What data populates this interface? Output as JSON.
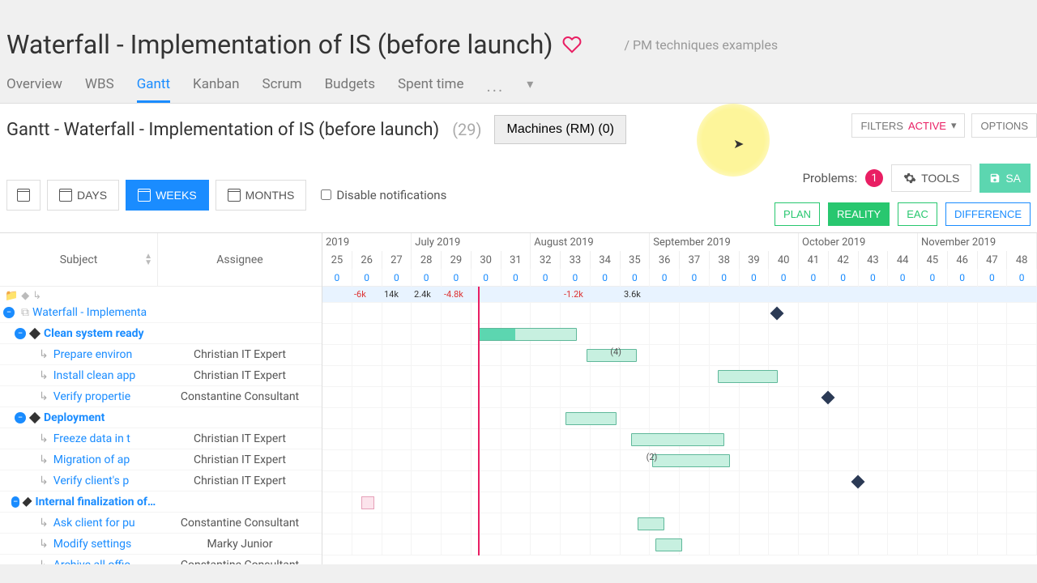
{
  "header": {
    "title": "Waterfall - Implementation of IS (before launch)",
    "breadcrumb": "/ PM techniques examples"
  },
  "tabs": {
    "items": [
      "Overview",
      "WBS",
      "Gantt",
      "Kanban",
      "Scrum",
      "Budgets",
      "Spent time"
    ],
    "active": 2,
    "more": "..."
  },
  "subheader": {
    "title": "Gantt - Waterfall - Implementation of IS (before launch)",
    "count": "(29)",
    "machines": "Machines (RM) (0)",
    "filters_label": "FILTERS",
    "filters_state": "ACTIVE",
    "options": "OPTIONS"
  },
  "toolbar": {
    "days": "DAYS",
    "weeks": "WEEKS",
    "months": "MONTHS",
    "disable_notifications": "Disable notifications",
    "problems_label": "Problems:",
    "problems_count": "1",
    "tools": "TOOLS",
    "save": "SA"
  },
  "modes": {
    "plan": "PLAN",
    "reality": "REALITY",
    "eac": "EAC",
    "difference": "DIFFERENCE"
  },
  "columns": {
    "subject": "Subject",
    "assignee": "Assignee"
  },
  "timeline": {
    "months": [
      {
        "label": "2019",
        "weeks": 3
      },
      {
        "label": "July 2019",
        "weeks": 4
      },
      {
        "label": "August 2019",
        "weeks": 4
      },
      {
        "label": "September 2019",
        "weeks": 5
      },
      {
        "label": "October 2019",
        "weeks": 4
      },
      {
        "label": "November 2019",
        "weeks": 4
      }
    ],
    "weeks": [
      "25",
      "26",
      "27",
      "28",
      "29",
      "30",
      "31",
      "32",
      "33",
      "34",
      "35",
      "36",
      "37",
      "38",
      "39",
      "40",
      "41",
      "42",
      "43",
      "44",
      "45",
      "46",
      "47",
      "48"
    ],
    "values": [
      "0",
      "0",
      "0",
      "0",
      "0",
      "0",
      "0",
      "0",
      "0",
      "0",
      "0",
      "0",
      "0",
      "0",
      "0",
      "0",
      "0",
      "0",
      "0",
      "0",
      "0",
      "0",
      "0",
      "0"
    ],
    "budgets": [
      {
        "col": 1,
        "text": "-6k",
        "neg": true
      },
      {
        "col": 2,
        "text": "14k"
      },
      {
        "col": 3,
        "text": "2.4k"
      },
      {
        "col": 4,
        "text": "-4.8k",
        "neg": true
      },
      {
        "col": 8,
        "text": "-1.2k",
        "neg": true
      },
      {
        "col": 10,
        "text": "3.6k"
      }
    ]
  },
  "rows": [
    {
      "type": "root",
      "subject": "Waterfall - Implementa",
      "assignee": "",
      "collapse": true,
      "copy": true
    },
    {
      "type": "group",
      "subject": "Clean system ready",
      "assignee": "",
      "indent": 1,
      "milestone_col": 15
    },
    {
      "type": "task",
      "subject": "Prepare environ",
      "assignee": "Christian IT Expert",
      "indent": 2,
      "bar": {
        "start": 5.2,
        "width": 3.3,
        "progress": 1.2
      }
    },
    {
      "type": "task",
      "subject": "Install clean app",
      "assignee": "Christian IT Expert",
      "indent": 2,
      "bar": {
        "start": 8.8,
        "width": 1.7
      },
      "badge": "(4)",
      "badge_col": 9.6
    },
    {
      "type": "task",
      "subject": "Verify propertie",
      "assignee": "Constantine Consultant",
      "indent": 2,
      "bar": {
        "start": 13.2,
        "width": 2
      }
    },
    {
      "type": "group",
      "subject": "Deployment",
      "assignee": "",
      "indent": 1,
      "milestone_col": 16.7
    },
    {
      "type": "task",
      "subject": "Freeze data in t",
      "assignee": "Christian IT Expert",
      "indent": 2,
      "bar": {
        "start": 8.1,
        "width": 1.7
      }
    },
    {
      "type": "task",
      "subject": "Migration of ap",
      "assignee": "Christian IT Expert",
      "indent": 2,
      "bar": {
        "start": 10.3,
        "width": 3.1
      }
    },
    {
      "type": "task",
      "subject": "Verify client's p",
      "assignee": "Christian IT Expert",
      "indent": 2,
      "bar": {
        "start": 11,
        "width": 2.6
      },
      "badge": "(2)",
      "badge_col": 10.8
    },
    {
      "type": "group",
      "subject": "Internal finalization of the project",
      "assignee": "",
      "indent": 1,
      "milestone_col": 17.7
    },
    {
      "type": "task",
      "subject": "Ask client for pu",
      "assignee": "Constantine Consultant",
      "indent": 2,
      "pink_col": 1.3
    },
    {
      "type": "task",
      "subject": "Modify settings",
      "assignee": "Marky Junior",
      "indent": 2,
      "bar": {
        "start": 10.5,
        "width": 0.9
      }
    },
    {
      "type": "task",
      "subject": "Archive all offic",
      "assignee": "Constantine Consultant",
      "indent": 2,
      "bar": {
        "start": 11.1,
        "width": 0.9
      }
    }
  ]
}
